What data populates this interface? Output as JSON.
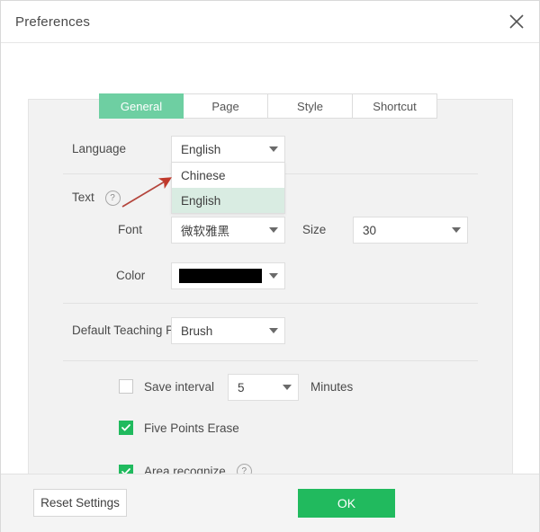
{
  "window": {
    "title": "Preferences",
    "close_icon": "close-icon"
  },
  "tabs": [
    {
      "label": "General",
      "active": true
    },
    {
      "label": "Page",
      "active": false
    },
    {
      "label": "Style",
      "active": false
    },
    {
      "label": "Shortcut",
      "active": false
    }
  ],
  "form": {
    "language": {
      "label": "Language",
      "value": "English",
      "options": [
        "Chinese",
        "English"
      ],
      "selected_option": "English",
      "open": true
    },
    "text": {
      "label": "Text",
      "help_icon": "help-circle-icon"
    },
    "font": {
      "label": "Font",
      "value": "微软雅黑"
    },
    "size": {
      "label": "Size",
      "value": "30"
    },
    "color": {
      "label": "Color",
      "value": "#000000"
    },
    "default_teaching": {
      "label": "Default Teaching P",
      "value": "Brush"
    },
    "save_interval": {
      "label": "Save interval",
      "checked": false,
      "value": "5",
      "unit": "Minutes"
    },
    "five_points_erase": {
      "label": "Five Points Erase",
      "checked": true
    },
    "area_recognize": {
      "label": "Area recognize",
      "checked": true,
      "help_icon": "help-circle-icon"
    }
  },
  "footer": {
    "reset_label": "Reset Settings",
    "ok_label": "OK"
  },
  "annotation": {
    "arrow_color": "#c0392b",
    "points_to": "Chinese"
  },
  "colors": {
    "accent_green": "#21ba5e",
    "tab_active_green": "#6ecfa2",
    "dropdown_highlight": "#d9ece2",
    "panel_bg": "#f2f2f2"
  }
}
